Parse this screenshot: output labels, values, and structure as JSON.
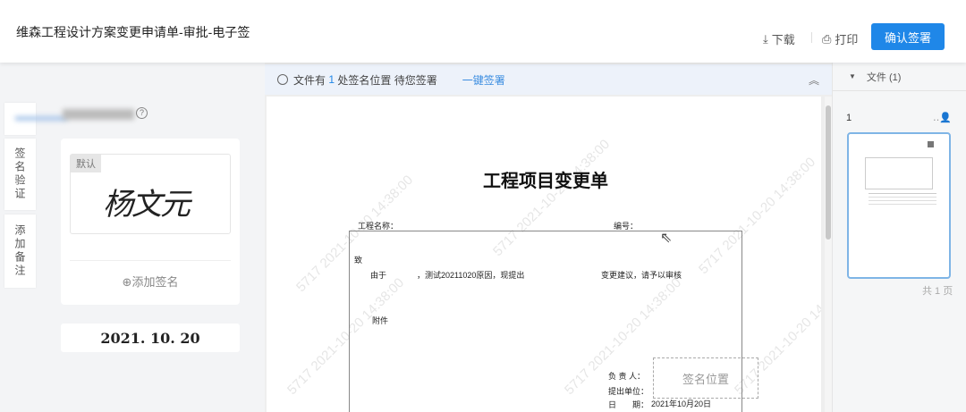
{
  "header": {
    "title": "维森工程设计方案变更申请单-审批-电子签",
    "download": "下载",
    "print": "打印",
    "confirm": "确认签署"
  },
  "left": {
    "tabs": [
      "",
      "签名验证",
      "添加备注"
    ],
    "signature_default_tag": "默认",
    "signature_name": "杨文元",
    "add_signature": "⊕添加签名",
    "date": "2021. 10. 20"
  },
  "infobar": {
    "prefix": "文件有",
    "count": "1",
    "suffix": "处签名位置 待您签署",
    "one_click": "一键签署"
  },
  "document": {
    "title": "工程项目变更单",
    "watermark": "5717 2021-10-20 14:38:00",
    "project_name_label": "工程名称：",
    "number_label": "编号：",
    "to_label": "致",
    "reason_prefix": "由于",
    "reason_mid": "，测试20211020原因，现提出",
    "reason_suffix": "变更建议，请予以审核",
    "attachment": "附件",
    "responsible": "负 责 人：",
    "submit_unit": "提出单位：",
    "date_label": "日　　期：",
    "date_value": "2021年10月20日",
    "sign_position": "签名位置"
  },
  "right": {
    "files_label": "文件 (1)",
    "page_number": "1",
    "total_pages": "共 1 页"
  }
}
